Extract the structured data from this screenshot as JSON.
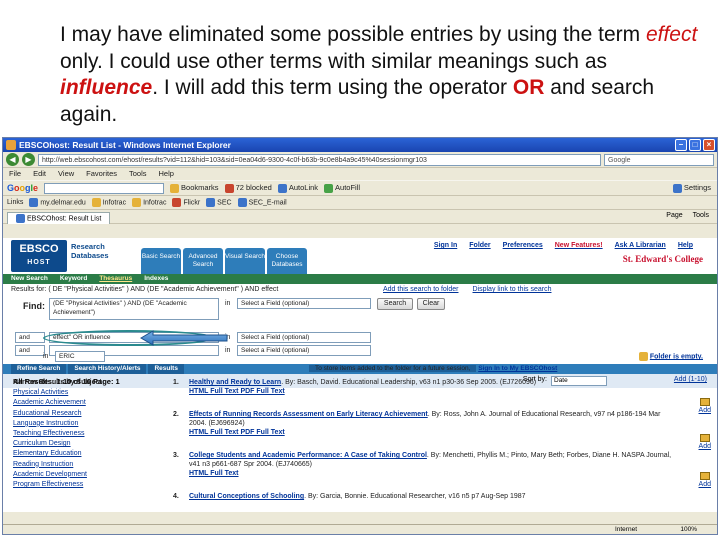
{
  "caption": {
    "p1": "I may have eliminated some possible entries by using the term ",
    "w1": "effect",
    "p2": " only.  I could use other terms with similar meanings such as ",
    "w2": "influence",
    "p3": ".  I will add this term using the operator ",
    "w3": "OR",
    "p4": " and search again."
  },
  "browser": {
    "title": "EBSCOhost: Result List - Windows Internet Explorer",
    "address": "http://web.ebscohost.com/ehost/results?vid=112&hid=103&sid=0ea04d6-9300-4c0f-b63b-9c0e8b4a9c45%40sessionmgr103",
    "search_box": "Google",
    "menu": [
      "File",
      "Edit",
      "View",
      "Favorites",
      "Tools",
      "Help"
    ],
    "toolbar": {
      "google": "Google",
      "bookmarks": "Bookmarks",
      "blocked": "72 blocked",
      "autolink": "AutoLink",
      "autofill": "AutoFill",
      "settings": "Settings"
    },
    "links": [
      "Links",
      "my.delmar.edu",
      "Infotrac",
      "Infotrac",
      "Flickr",
      "SEC",
      "SEC_E-mail"
    ],
    "tab": "EBSCOhost: Result List",
    "tabtools": [
      "Page",
      "Tools"
    ],
    "status": {
      "zone": "Internet",
      "zoom": "100%"
    }
  },
  "ebsco": {
    "logo_top": "EBSCO",
    "logo_bottom": "HOST",
    "research_databases": [
      "Research",
      "Databases"
    ],
    "top_tabs": [
      "Basic Search",
      "Advanced Search",
      "Visual Search",
      "Choose Databases"
    ],
    "top_links": [
      "Sign In",
      "Folder",
      "Preferences",
      "New Features!",
      "Ask A Librarian",
      "Help"
    ],
    "college": "St. Edward's College",
    "green_tabs": [
      "New Search",
      "Keyword",
      "Thesaurus",
      "Indexes"
    ],
    "green_selected": "Thesaurus",
    "results_for": "Results for: ( DE \"Physical Activities\" ) AND (DE \"Academic Achievement\" ) AND effect",
    "folder_links": [
      "Add this search to folder",
      "Display link to this search"
    ],
    "find_label": "Find:",
    "query1": "(DE \"Physical Activities\" ) AND (DE \"Academic Achievement\")",
    "op2": "and",
    "query2": "effect\" OR influence",
    "op3": "and",
    "query3": "",
    "in_label": "in",
    "field_placeholder": "Select a Field (optional)",
    "search_btn": "Search",
    "clear_btn": "Clear",
    "db_label": "in",
    "database": "ERIC",
    "folder_empty": "Folder is empty.",
    "blue_tabs": [
      "Refine Search",
      "Search History/Alerts",
      "Results"
    ],
    "folder_note": "To store items added to the folder for a future session,",
    "folder_note_link": "Sign In to My EBSCOhost",
    "results_label": "All Results: 1-10 of 10    Page: 1",
    "sort_by": "Sort by:",
    "sort_value": "Date",
    "add_all": "Add (1-10)",
    "narrow": {
      "heading": "Narrow Results by Subject",
      "items": [
        "Physical Activities",
        "Academic Achievement",
        "Educational Research",
        "Language Instruction",
        "Teaching Effectiveness",
        "Curriculum Design",
        "Elementary Education",
        "Reading Instruction",
        "Academic Development",
        "Program Effectiveness"
      ]
    },
    "results": [
      {
        "num": "1.",
        "title": "Healthy and Ready to Learn",
        "rest": ". By: Basch, David. Educational Leadership, v63 n1 p30-36 Sep 2005. (EJ726096)",
        "links": "HTML Full Text   PDF Full Text"
      },
      {
        "num": "2.",
        "title": "Effects of Running Records Assessment on Early Literacy Achievement",
        "rest": ". By: Ross, John A. Journal of Educational Research, v97 n4 p186-194 Mar 2004. (EJ696924)",
        "links": "HTML Full Text   PDF Full Text"
      },
      {
        "num": "3.",
        "title": "College Students and Academic Performance: A Case of Taking Control",
        "rest": ". By: Menchetti, Phyllis M.; Pinto, Mary Beth; Forbes, Diane H. NASPA Journal, v41 n3 p661-687 Spr 2004. (EJ740665)",
        "links": "HTML Full Text"
      },
      {
        "num": "4.",
        "title": "Cultural Conceptions of Schooling",
        "rest": ". By: Garcia, Bonnie. Educational Researcher, v16 n5 p7 Aug-Sep 1987",
        "links": ""
      }
    ],
    "add_label": "Add"
  }
}
